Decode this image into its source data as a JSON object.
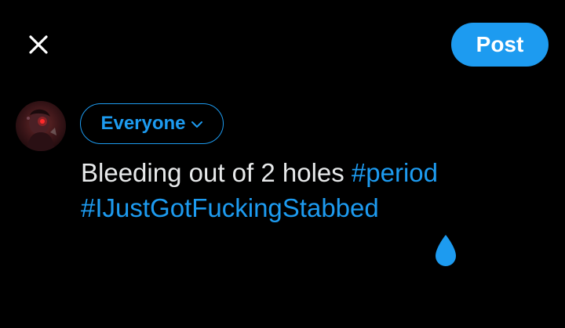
{
  "colors": {
    "accent": "#1d9bf0",
    "background": "#000000",
    "text": "#e7e9ea"
  },
  "header": {
    "close_icon": "close-icon",
    "post_label": "Post"
  },
  "composer": {
    "audience_label": "Everyone",
    "audience_icon": "chevron-down-icon",
    "text_plain": "Bleeding out of 2 holes ",
    "hashtag_1": "#period",
    "hashtag_2": "#IJustGotFuckingStabbed",
    "cursor_handle_icon": "text-selection-handle-icon"
  }
}
